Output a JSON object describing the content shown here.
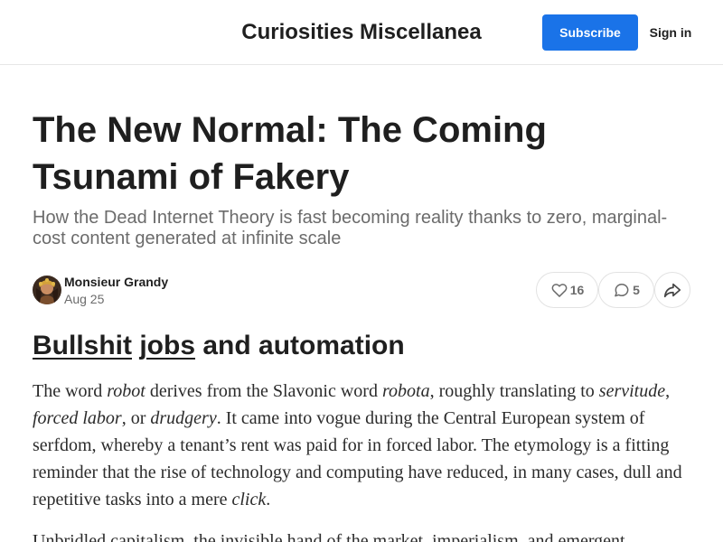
{
  "header": {
    "publication_title": "Curiosities Miscellanea",
    "subscribe_label": "Subscribe",
    "signin_label": "Sign in",
    "accent_color": "#1a73e8"
  },
  "post": {
    "title": "The New Normal: The Coming Tsunami of Fakery",
    "subtitle": "How the Dead Internet Theory is fast becoming reality thanks to zero, marginal-cost content generated at infinite scale",
    "author": "Monsieur Grandy",
    "date": "Aug 25",
    "like_count": "16",
    "comment_count": "5",
    "icons": {
      "like": "heart-icon",
      "comment": "comment-bubble-icon",
      "share": "share-arrow-icon"
    }
  },
  "body": {
    "section_heading": {
      "link1": "Bullshit",
      "space": " ",
      "link2": "jobs",
      "rest": " and automation"
    },
    "paragraph1": {
      "t1": "The word ",
      "e1": "robot",
      "t2": " derives from the Slavonic word ",
      "e2": "robota",
      "t3": ", roughly translating to ",
      "e3": "servitude",
      "t4": ", ",
      "e4": "forced labor",
      "t5": ", or ",
      "e5": "drudgery",
      "t6": ". It came into vogue during the Central European system of serfdom, whereby a tenant’s rent was paid for in forced labor. The etymology is a fitting reminder that the rise of technology and computing have reduced, in many cases, dull and repetitive tasks into a mere ",
      "e6": "click",
      "t7": "."
    },
    "paragraph2": "Unbridled capitalism, the invisible hand of the market, imperialism, and emergent"
  }
}
